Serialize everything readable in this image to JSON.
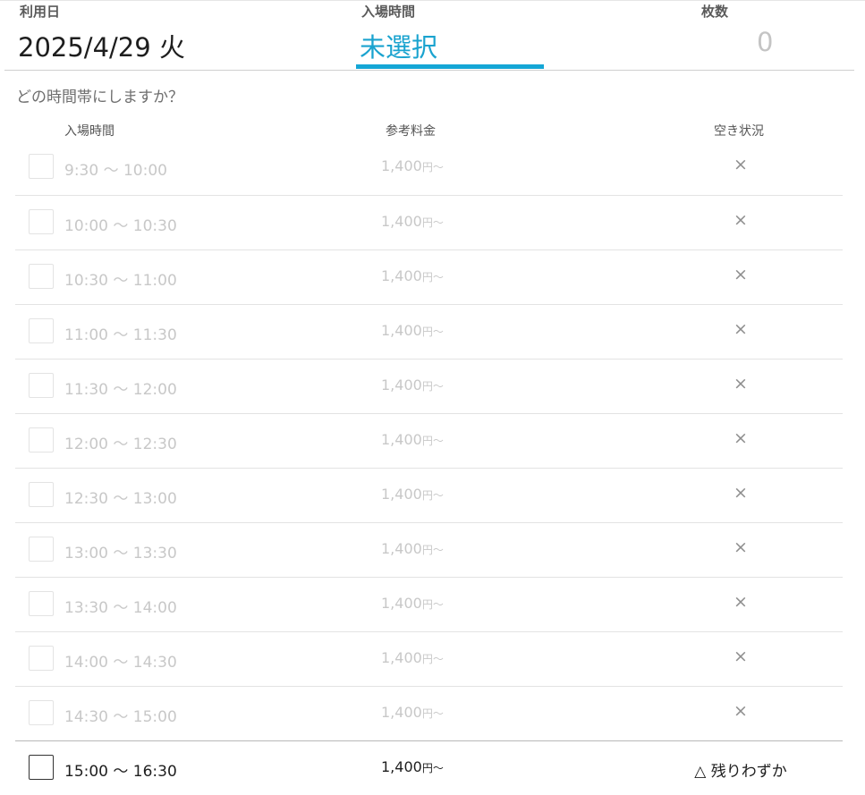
{
  "header": {
    "date": {
      "label": "利用日",
      "value": "2025/4/29 火"
    },
    "entry_time": {
      "label": "入場時間",
      "value": "未選択"
    },
    "tickets": {
      "label": "枚数",
      "value": "0"
    }
  },
  "question": "どの時間帯にしますか？",
  "columns": {
    "time": "入場時間",
    "price": "参考料金",
    "availability": "空き状況"
  },
  "slots": [
    {
      "time": "9:30 ～ 10:00",
      "price": "1,400",
      "yen": "円～",
      "availability": "×"
    },
    {
      "time": "10:00 ～ 10:30",
      "price": "1,400",
      "yen": "円～",
      "availability": "×"
    },
    {
      "time": "10:30 ～ 11:00",
      "price": "1,400",
      "yen": "円～",
      "availability": "×"
    },
    {
      "time": "11:00 ～ 11:30",
      "price": "1,400",
      "yen": "円～",
      "availability": "×"
    },
    {
      "time": "11:30 ～ 12:00",
      "price": "1,400",
      "yen": "円～",
      "availability": "×"
    },
    {
      "time": "12:00 ～ 12:30",
      "price": "1,400",
      "yen": "円～",
      "availability": "×"
    },
    {
      "time": "12:30 ～ 13:00",
      "price": "1,400",
      "yen": "円～",
      "availability": "×"
    },
    {
      "time": "13:00 ～ 13:30",
      "price": "1,400",
      "yen": "円～",
      "availability": "×"
    },
    {
      "time": "13:30 ～ 14:00",
      "price": "1,400",
      "yen": "円～",
      "availability": "×"
    },
    {
      "time": "14:00 ～ 14:30",
      "price": "1,400",
      "yen": "円～",
      "availability": "×"
    },
    {
      "time": "14:30 ～ 15:00",
      "price": "1,400",
      "yen": "円～",
      "availability": "×"
    },
    {
      "time": "15:00 ～ 16:30",
      "price": "1,400",
      "yen": "円～",
      "availability": "△ 残りわずか"
    }
  ]
}
